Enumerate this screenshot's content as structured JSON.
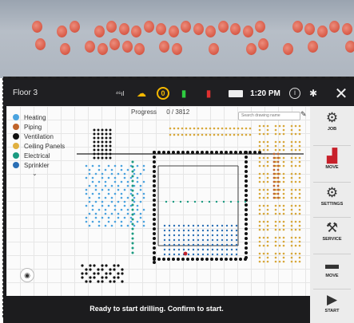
{
  "header": {
    "floor": "Floor 3",
    "signal": "⁴⁶ıl",
    "warning_count": "0",
    "time": "1:20 PM"
  },
  "legend": [
    {
      "label": "Heating",
      "color": "#4aa3df"
    },
    {
      "label": "Piping",
      "color": "#c0632a"
    },
    {
      "label": "Ventilation",
      "color": "#111111"
    },
    {
      "label": "Ceiling Panels",
      "color": "#e0b040"
    },
    {
      "label": "Electrical",
      "color": "#1a9a80"
    },
    {
      "label": "Sprinkler",
      "color": "#2a6fb5"
    }
  ],
  "progress": {
    "label": "Progress",
    "value": "0 / 3812"
  },
  "search": {
    "placeholder": "Search drawing name"
  },
  "sidebar": [
    {
      "label": "JOB",
      "icon": "gear-icon"
    },
    {
      "label": "MOVE",
      "icon": "robot-icon"
    },
    {
      "label": "SETTINGS",
      "icon": "gear-icon"
    },
    {
      "label": "SERVICE",
      "icon": "wrench-icon"
    },
    {
      "label": "MOVE",
      "icon": "drill-icon"
    },
    {
      "label": "START",
      "icon": "play-icon"
    }
  ],
  "status": "Ready to start drilling. Confirm to start."
}
